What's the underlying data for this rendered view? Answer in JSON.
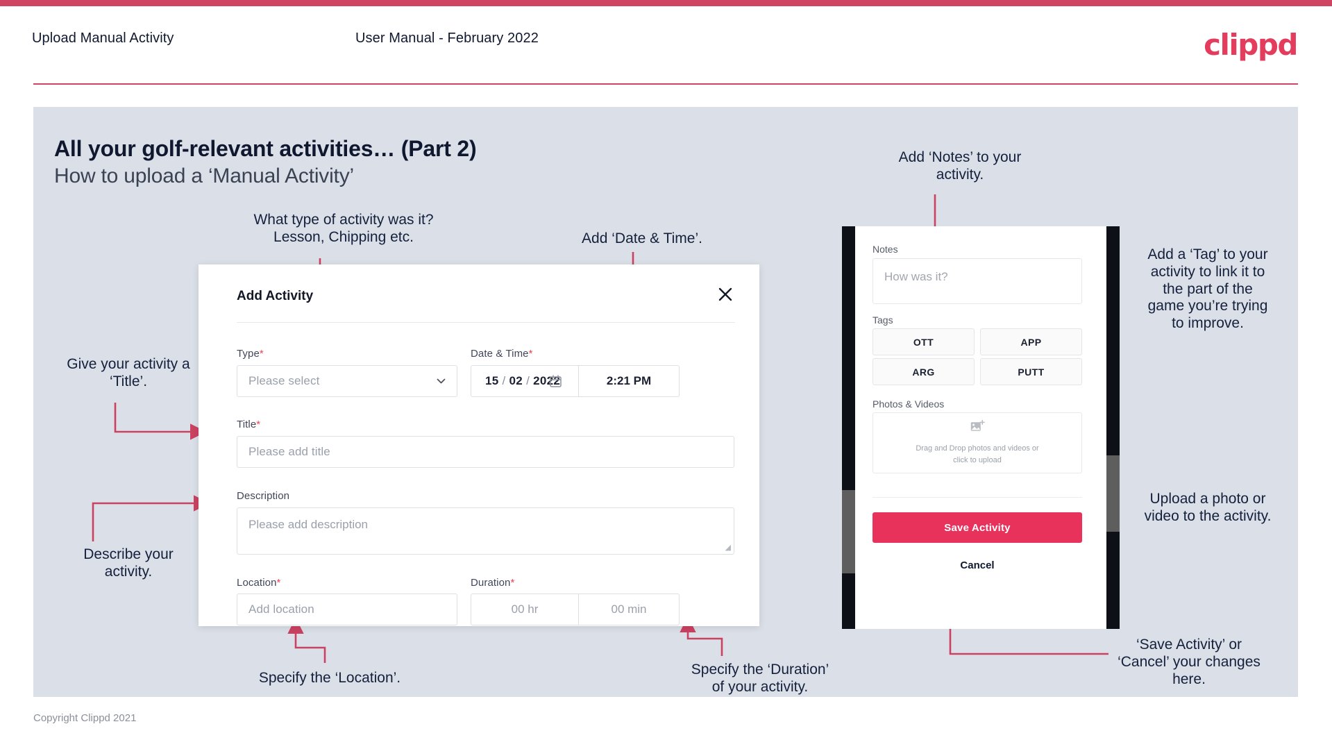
{
  "header": {
    "left_title": "Upload Manual Activity",
    "center_title": "User Manual - February 2022",
    "logo": "clippd"
  },
  "slide": {
    "heading": "All your golf-relevant activities… (Part 2)",
    "subheading": "How to upload a ‘Manual Activity’"
  },
  "annotations": {
    "type": "What type of activity was it?\nLesson, Chipping etc.",
    "datetime": "Add ‘Date & Time’.",
    "title": "Give your activity a\n‘Title’.",
    "description": "Describe your\nactivity.",
    "location": "Specify the ‘Location’.",
    "duration": "Specify the ‘Duration’\nof your activity.",
    "notes": "Add ‘Notes’ to your\nactivity.",
    "tags": "Add a ‘Tag’ to your\nactivity to link it to\nthe part of the\ngame you’re trying\nto improve.",
    "photos": "Upload a photo or\nvideo to the activity.",
    "save": "‘Save Activity’ or\n‘Cancel’ your changes\nhere."
  },
  "dialog": {
    "title": "Add Activity",
    "close_icon": "close-icon",
    "fields": {
      "type": {
        "label": "Type",
        "required": "*",
        "placeholder": "Please select"
      },
      "datetime": {
        "label": "Date & Time",
        "required": "*",
        "day": "15",
        "month": "02",
        "year": "2022",
        "separator": "/",
        "time": "2:21 PM"
      },
      "title": {
        "label": "Title",
        "required": "*",
        "placeholder": "Please add title"
      },
      "description": {
        "label": "Description",
        "placeholder": "Please add description"
      },
      "location": {
        "label": "Location",
        "required": "*",
        "placeholder": "Add location"
      },
      "duration": {
        "label": "Duration",
        "required": "*",
        "hours": "00 hr",
        "minutes": "00 min"
      }
    }
  },
  "phone": {
    "notes": {
      "label": "Notes",
      "placeholder": "How was it?"
    },
    "tags": {
      "label": "Tags",
      "items": [
        "OTT",
        "APP",
        "ARG",
        "PUTT"
      ]
    },
    "photos": {
      "label": "Photos & Videos",
      "dropzone_line1": "Drag and Drop photos and videos or",
      "dropzone_line2": "click to upload",
      "icon": "add-photo-icon"
    },
    "save_label": "Save Activity",
    "cancel_label": "Cancel"
  },
  "footer": {
    "copyright": "Copyright Clippd 2021"
  },
  "colors": {
    "brand": "#e43c5c",
    "accent_bar": "#cf4463",
    "save_button": "#e8315b",
    "panel_bg": "#dbe0e8",
    "heading": "#10182f",
    "required": "#f2444f",
    "connector": "#cb4261"
  }
}
